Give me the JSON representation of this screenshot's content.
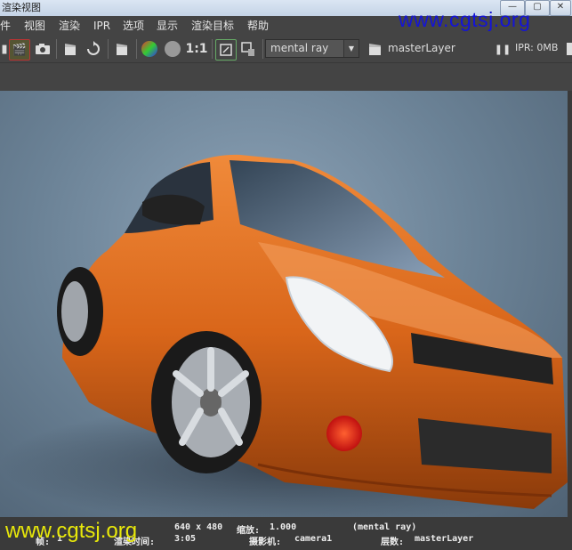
{
  "window": {
    "title": "渲染视图",
    "minimize": "—",
    "maximize": "▢",
    "close": "✕"
  },
  "menu": [
    "件",
    "视图",
    "渲染",
    "IPR",
    "选项",
    "显示",
    "渲染目标",
    "帮助"
  ],
  "watermark_top": "www.cgtsj.org",
  "watermark_bottom": "www.cgtsj.org",
  "toolbar": {
    "ratio_label": "1:1",
    "renderer": "mental ray",
    "layer": "masterLayer",
    "ipr_label": "IPR: 0MB"
  },
  "status": {
    "size": "640 x 480",
    "zoom_label": "缩放:",
    "zoom_value": "1.000",
    "renderer": "(mental ray)",
    "frame_label": "帧:",
    "frame_value": "1",
    "time_label": "渲染时间:",
    "time_value": "3:05",
    "camera_label": "摄影机:",
    "camera_value": "camera1",
    "layer_label": "层数:",
    "layer_value": "masterLayer"
  },
  "colors": {
    "car_body": "#d9661a",
    "background": "#6b8296",
    "watermark_top": "#1414d6",
    "watermark_bottom": "#e8e80a"
  }
}
